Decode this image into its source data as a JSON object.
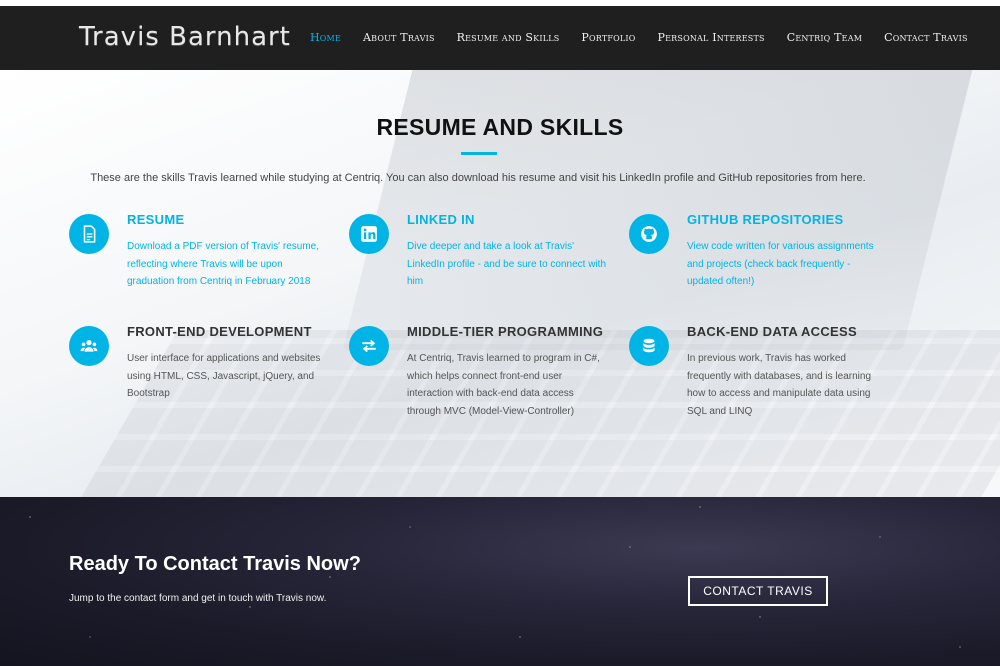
{
  "header": {
    "brand": "Travis Barnhart",
    "nav": [
      {
        "label": "Home",
        "active": true
      },
      {
        "label": "About Travis",
        "active": false
      },
      {
        "label": "Resume and Skills",
        "active": false
      },
      {
        "label": "Portfolio",
        "active": false
      },
      {
        "label": "Personal Interests",
        "active": false
      },
      {
        "label": "Centriq Team",
        "active": false
      },
      {
        "label": "Contact Travis",
        "active": false
      }
    ]
  },
  "skills": {
    "title": "RESUME AND SKILLS",
    "intro": "These are the skills Travis learned while studying at Centriq. You can also download his resume and visit his LinkedIn profile and GitHub repositories from here.",
    "items": [
      {
        "icon": "document-icon",
        "title": "RESUME",
        "text": "Download a PDF version of Travis' resume, reflecting where Travis will be upon graduation from Centriq in February 2018"
      },
      {
        "icon": "linkedin-icon",
        "title": "LINKED IN",
        "text": "Dive deeper and take a look at Travis' LinkedIn profile - and be sure to connect with him"
      },
      {
        "icon": "github-icon",
        "title": "GITHUB REPOSITORIES",
        "text": "View code written for various assignments and projects (check back frequently - updated often!)"
      },
      {
        "icon": "users-icon",
        "title": "FRONT-END DEVELOPMENT",
        "text": "User interface for applications and websites using HTML, CSS, Javascript, jQuery, and Bootstrap"
      },
      {
        "icon": "exchange-icon",
        "title": "MIDDLE-TIER PROGRAMMING",
        "text": "At Centriq, Travis learned to program in C#, which helps connect front-end user interaction with back-end data access through MVC (Model-View-Controller)"
      },
      {
        "icon": "database-icon",
        "title": "BACK-END DATA ACCESS",
        "text": "In previous work, Travis has worked frequently with databases, and is learning how to access and manipulate data using SQL and LINQ"
      }
    ]
  },
  "contact": {
    "title": "Ready To Contact Travis Now?",
    "text": "Jump to the contact form and get in touch with Travis now.",
    "button": "CONTACT TRAVIS"
  },
  "colors": {
    "accent": "#00b4e6",
    "topbar": "#1f1f1f"
  }
}
